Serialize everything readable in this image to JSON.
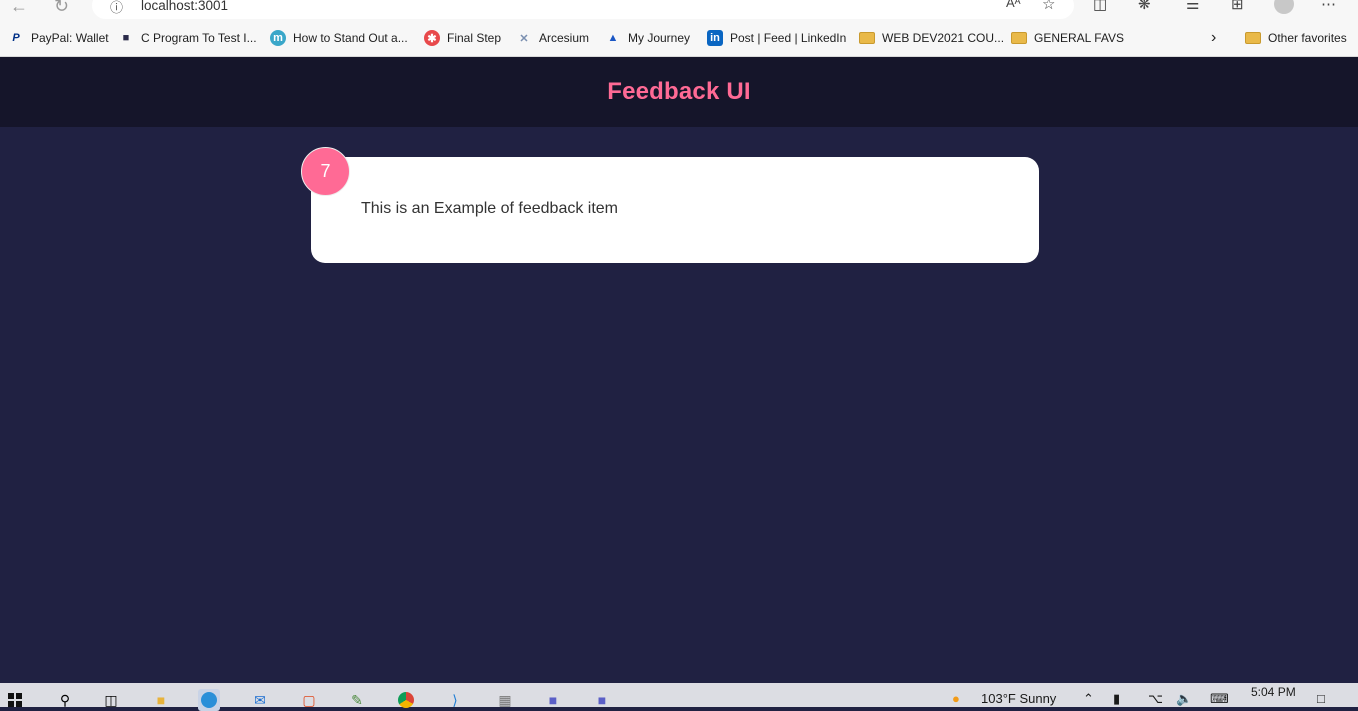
{
  "browser": {
    "url": "localhost:3001",
    "read_aloud_label": "Aᴬ",
    "bookmarks": [
      {
        "label": "PayPal: Wallet",
        "icon": "paypal-icon"
      },
      {
        "label": "C Program To Test I...",
        "icon": "site-icon"
      },
      {
        "label": "How to Stand Out a...",
        "icon": "medium-icon"
      },
      {
        "label": "Final Step",
        "icon": "final-step-icon"
      },
      {
        "label": "Arcesium",
        "icon": "arcesium-icon"
      },
      {
        "label": "My Journey",
        "icon": "journey-icon"
      },
      {
        "label": "Post | Feed | LinkedIn",
        "icon": "linkedin-icon"
      },
      {
        "label": "WEB DEV2021 COU...",
        "icon": "folder-icon"
      },
      {
        "label": "GENERAL FAVS",
        "icon": "folder-icon"
      }
    ],
    "other_favorites": "Other favorites"
  },
  "app": {
    "title": "Feedback UI",
    "feedback": {
      "rating": "7",
      "text": "This is an Example of feedback item"
    },
    "colors": {
      "accent": "#ff6a95",
      "background": "#202142",
      "header": "#15152a",
      "card": "#ffffff"
    }
  },
  "taskbar": {
    "weather": "103°F  Sunny",
    "time": "5:04 PM"
  }
}
